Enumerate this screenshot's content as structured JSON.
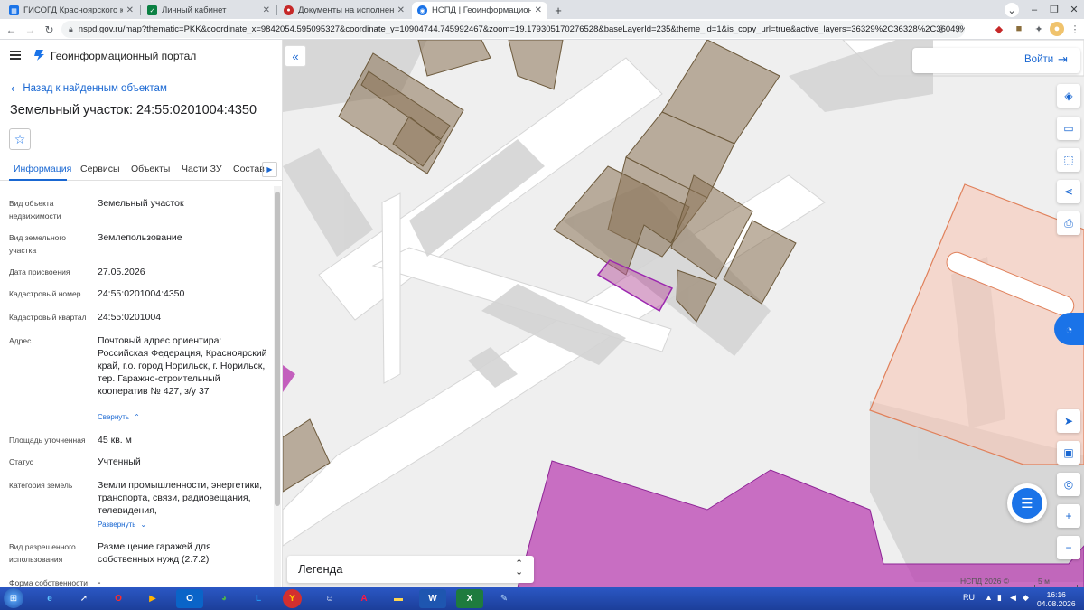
{
  "browser": {
    "tabs": [
      {
        "title": "ГИСОГД Красноярского края",
        "icon": "gisogd-icon",
        "color": "#1a73e8"
      },
      {
        "title": "Личный кабинет",
        "icon": "cabinet-icon",
        "color": "#0b8043"
      },
      {
        "title": "Документы на исполнении",
        "icon": "documents-icon",
        "color": "#c62828"
      },
      {
        "title": "НСПД | Геоинформационный п",
        "icon": "nspd-icon",
        "color": "#1a73e8"
      }
    ],
    "url": "nspd.gov.ru/map?thematic=PKK&coordinate_x=9842054.595095327&coordinate_y=10904744.745992467&zoom=19.179305170276528&baseLayerId=235&theme_id=1&is_copy_url=true&active_layers=36329%2C36328%2C36049%2C36048&..."
  },
  "sidebar": {
    "brand": "Геоинформационный портал",
    "back_label": "Назад к найденным объектам",
    "title": "Земельный участок: 24:55:0201004:4350",
    "tabs": [
      "Информация",
      "Сервисы",
      "Объекты",
      "Части ЗУ",
      "Состав"
    ],
    "props": {
      "obj_type_label": "Вид объекта недвижимости",
      "obj_type_value": "Земельный участок",
      "land_type_label": "Вид земельного участка",
      "land_type_value": "Землепользование",
      "date_label": "Дата присвоения",
      "date_value": "27.05.2026",
      "cad_num_label": "Кадастровый номер",
      "cad_num_value": "24:55:0201004:4350",
      "cad_quarter_label": "Кадастровый квартал",
      "cad_quarter_value": "24:55:0201004",
      "address_label": "Адрес",
      "address_value": "Почтовый адрес ориентира: Российская Федерация, Красноярский край, г.о. город Норильск, г. Норильск, тер. Гаражно-строительный кооператив № 427, з/у 37",
      "collapse_link": "Свернуть",
      "area_label": "Площадь уточненная",
      "area_value": "45 кв. м",
      "status_label": "Статус",
      "status_value": "Учтенный",
      "category_label": "Категория земель",
      "category_value": "Земли промышленности, энергетики, транспорта, связи, радиовещания, телевидения,",
      "expand_link": "Развернуть",
      "permitted_use_label": "Вид разрешенного использования",
      "permitted_use_value": "Размещение гаражей для собственных нужд (2.7.2)",
      "ownership_label": "Форма собственности",
      "ownership_value": "-"
    }
  },
  "map": {
    "login_label": "Войти",
    "legend_label": "Легенда",
    "copyright": "НСПД 2026 ©",
    "scale_label": "5 м"
  },
  "taskbar": {
    "lang": "RU",
    "time": "16:16",
    "date": "04.08.2026"
  }
}
